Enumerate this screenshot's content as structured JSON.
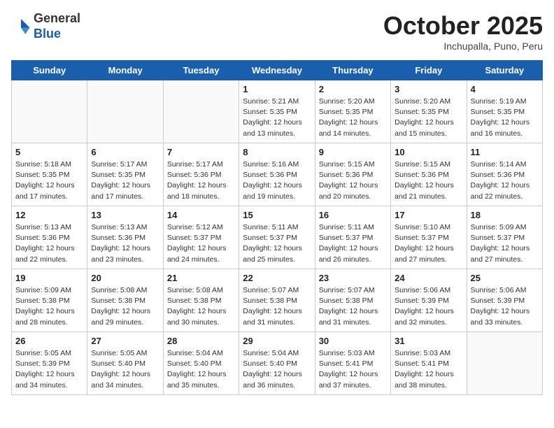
{
  "header": {
    "logo_general": "General",
    "logo_blue": "Blue",
    "month_title": "October 2025",
    "subtitle": "Inchupalla, Puno, Peru"
  },
  "weekdays": [
    "Sunday",
    "Monday",
    "Tuesday",
    "Wednesday",
    "Thursday",
    "Friday",
    "Saturday"
  ],
  "weeks": [
    [
      {
        "day": "",
        "info": ""
      },
      {
        "day": "",
        "info": ""
      },
      {
        "day": "",
        "info": ""
      },
      {
        "day": "1",
        "info": "Sunrise: 5:21 AM\nSunset: 5:35 PM\nDaylight: 12 hours\nand 13 minutes."
      },
      {
        "day": "2",
        "info": "Sunrise: 5:20 AM\nSunset: 5:35 PM\nDaylight: 12 hours\nand 14 minutes."
      },
      {
        "day": "3",
        "info": "Sunrise: 5:20 AM\nSunset: 5:35 PM\nDaylight: 12 hours\nand 15 minutes."
      },
      {
        "day": "4",
        "info": "Sunrise: 5:19 AM\nSunset: 5:35 PM\nDaylight: 12 hours\nand 16 minutes."
      }
    ],
    [
      {
        "day": "5",
        "info": "Sunrise: 5:18 AM\nSunset: 5:35 PM\nDaylight: 12 hours\nand 17 minutes."
      },
      {
        "day": "6",
        "info": "Sunrise: 5:17 AM\nSunset: 5:35 PM\nDaylight: 12 hours\nand 17 minutes."
      },
      {
        "day": "7",
        "info": "Sunrise: 5:17 AM\nSunset: 5:36 PM\nDaylight: 12 hours\nand 18 minutes."
      },
      {
        "day": "8",
        "info": "Sunrise: 5:16 AM\nSunset: 5:36 PM\nDaylight: 12 hours\nand 19 minutes."
      },
      {
        "day": "9",
        "info": "Sunrise: 5:15 AM\nSunset: 5:36 PM\nDaylight: 12 hours\nand 20 minutes."
      },
      {
        "day": "10",
        "info": "Sunrise: 5:15 AM\nSunset: 5:36 PM\nDaylight: 12 hours\nand 21 minutes."
      },
      {
        "day": "11",
        "info": "Sunrise: 5:14 AM\nSunset: 5:36 PM\nDaylight: 12 hours\nand 22 minutes."
      }
    ],
    [
      {
        "day": "12",
        "info": "Sunrise: 5:13 AM\nSunset: 5:36 PM\nDaylight: 12 hours\nand 22 minutes."
      },
      {
        "day": "13",
        "info": "Sunrise: 5:13 AM\nSunset: 5:36 PM\nDaylight: 12 hours\nand 23 minutes."
      },
      {
        "day": "14",
        "info": "Sunrise: 5:12 AM\nSunset: 5:37 PM\nDaylight: 12 hours\nand 24 minutes."
      },
      {
        "day": "15",
        "info": "Sunrise: 5:11 AM\nSunset: 5:37 PM\nDaylight: 12 hours\nand 25 minutes."
      },
      {
        "day": "16",
        "info": "Sunrise: 5:11 AM\nSunset: 5:37 PM\nDaylight: 12 hours\nand 26 minutes."
      },
      {
        "day": "17",
        "info": "Sunrise: 5:10 AM\nSunset: 5:37 PM\nDaylight: 12 hours\nand 27 minutes."
      },
      {
        "day": "18",
        "info": "Sunrise: 5:09 AM\nSunset: 5:37 PM\nDaylight: 12 hours\nand 27 minutes."
      }
    ],
    [
      {
        "day": "19",
        "info": "Sunrise: 5:09 AM\nSunset: 5:38 PM\nDaylight: 12 hours\nand 28 minutes."
      },
      {
        "day": "20",
        "info": "Sunrise: 5:08 AM\nSunset: 5:38 PM\nDaylight: 12 hours\nand 29 minutes."
      },
      {
        "day": "21",
        "info": "Sunrise: 5:08 AM\nSunset: 5:38 PM\nDaylight: 12 hours\nand 30 minutes."
      },
      {
        "day": "22",
        "info": "Sunrise: 5:07 AM\nSunset: 5:38 PM\nDaylight: 12 hours\nand 31 minutes."
      },
      {
        "day": "23",
        "info": "Sunrise: 5:07 AM\nSunset: 5:38 PM\nDaylight: 12 hours\nand 31 minutes."
      },
      {
        "day": "24",
        "info": "Sunrise: 5:06 AM\nSunset: 5:39 PM\nDaylight: 12 hours\nand 32 minutes."
      },
      {
        "day": "25",
        "info": "Sunrise: 5:06 AM\nSunset: 5:39 PM\nDaylight: 12 hours\nand 33 minutes."
      }
    ],
    [
      {
        "day": "26",
        "info": "Sunrise: 5:05 AM\nSunset: 5:39 PM\nDaylight: 12 hours\nand 34 minutes."
      },
      {
        "day": "27",
        "info": "Sunrise: 5:05 AM\nSunset: 5:40 PM\nDaylight: 12 hours\nand 34 minutes."
      },
      {
        "day": "28",
        "info": "Sunrise: 5:04 AM\nSunset: 5:40 PM\nDaylight: 12 hours\nand 35 minutes."
      },
      {
        "day": "29",
        "info": "Sunrise: 5:04 AM\nSunset: 5:40 PM\nDaylight: 12 hours\nand 36 minutes."
      },
      {
        "day": "30",
        "info": "Sunrise: 5:03 AM\nSunset: 5:41 PM\nDaylight: 12 hours\nand 37 minutes."
      },
      {
        "day": "31",
        "info": "Sunrise: 5:03 AM\nSunset: 5:41 PM\nDaylight: 12 hours\nand 38 minutes."
      },
      {
        "day": "",
        "info": ""
      }
    ]
  ]
}
